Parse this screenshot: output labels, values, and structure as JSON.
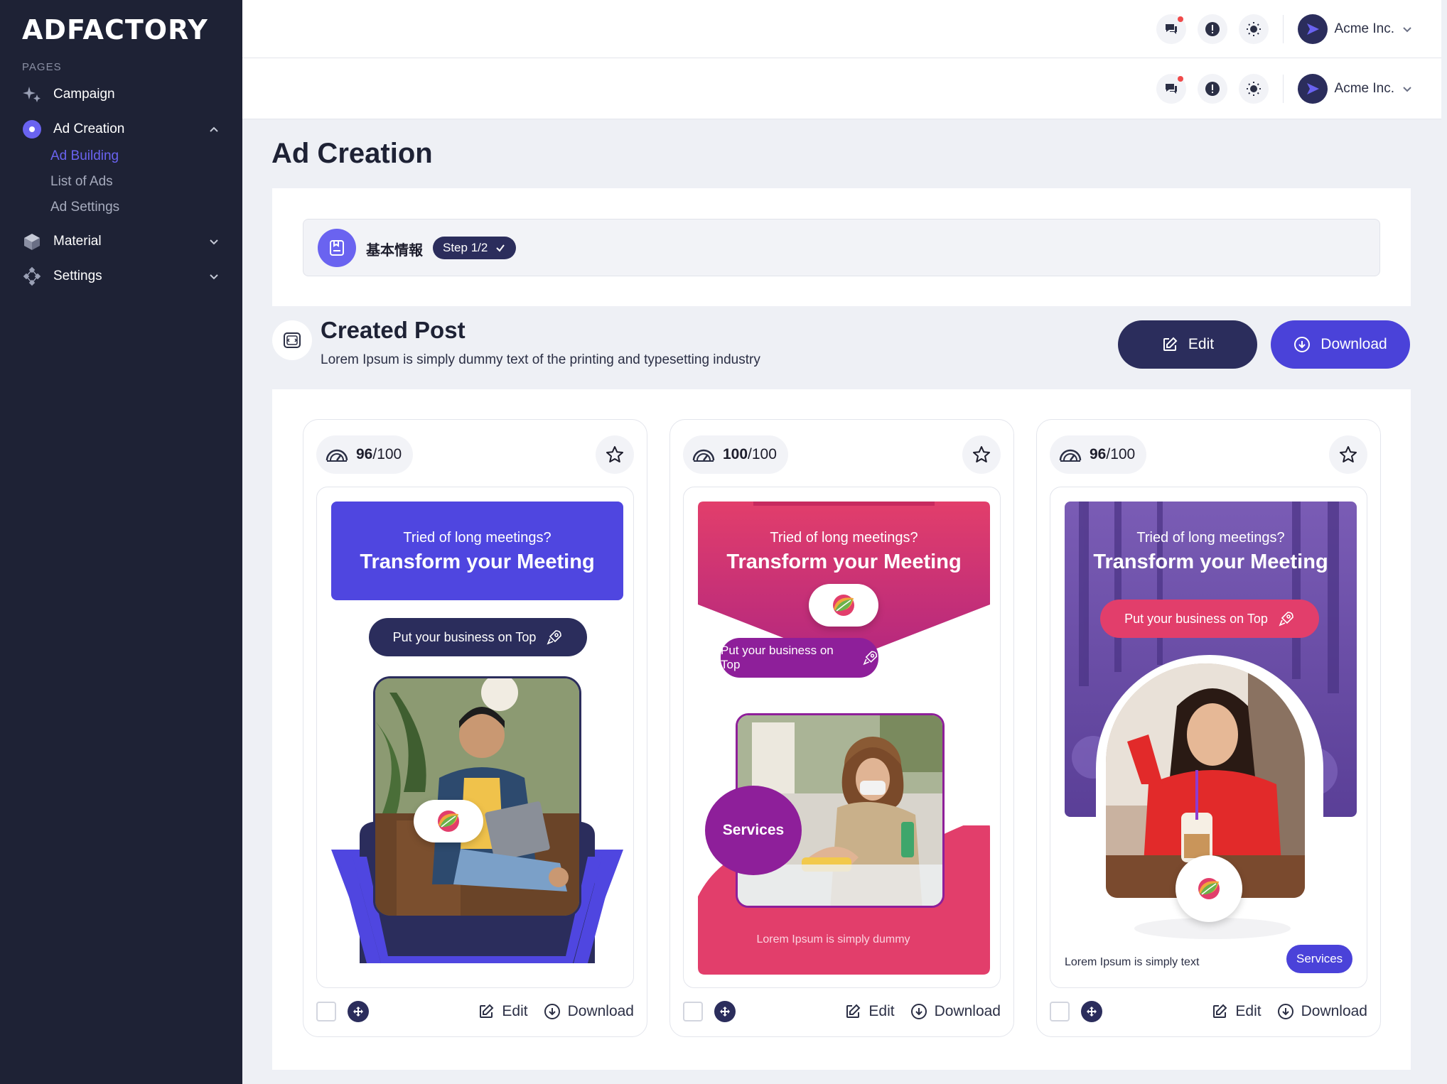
{
  "brand": "ADFACTORY",
  "sidebar": {
    "section_label": "PAGES",
    "items": [
      {
        "label": "Campaign"
      },
      {
        "label": "Ad Creation"
      },
      {
        "label": "Material"
      },
      {
        "label": "Settings"
      }
    ],
    "sub_items": [
      {
        "label": "Ad Building",
        "active": true
      },
      {
        "label": "List of Ads"
      },
      {
        "label": "Ad Settings"
      }
    ]
  },
  "topbar": {
    "account": "Acme Inc."
  },
  "page_title": "Ad Creation",
  "step": {
    "title": "基本情報",
    "badge": "Step 1/2"
  },
  "created_post": {
    "title": "Created Post",
    "subtitle": "Lorem Ipsum is simply dummy text of the printing and typesetting industry",
    "edit_label": "Edit",
    "download_label": "Download"
  },
  "cards": [
    {
      "score": "96",
      "score_max": "/100",
      "headline_small": "Tried of long meetings?",
      "headline_big": "Transform your Meeting",
      "cta": "Put your business on Top",
      "edit": "Edit",
      "download": "Download"
    },
    {
      "score": "100",
      "score_max": "/100",
      "headline_small": "Tried of long meetings?",
      "headline_big": "Transform your Meeting",
      "cta": "Put your business on Top",
      "badge": "Services",
      "footer_text": "Lorem Ipsum is simply dummy",
      "edit": "Edit",
      "download": "Download"
    },
    {
      "score": "96",
      "score_max": "/100",
      "headline_small": "Tried of long meetings?",
      "headline_big": "Transform your Meeting",
      "cta": "Put your business on Top",
      "badge": "Services",
      "footer_text": "Lorem Ipsum is simply text",
      "edit": "Edit",
      "download": "Download"
    }
  ],
  "colors": {
    "sidebar": "#1e2235",
    "accent": "#4a42d9",
    "navy": "#2b2d5c",
    "pink": "#e23e6b",
    "purple": "#8e1f9a"
  }
}
